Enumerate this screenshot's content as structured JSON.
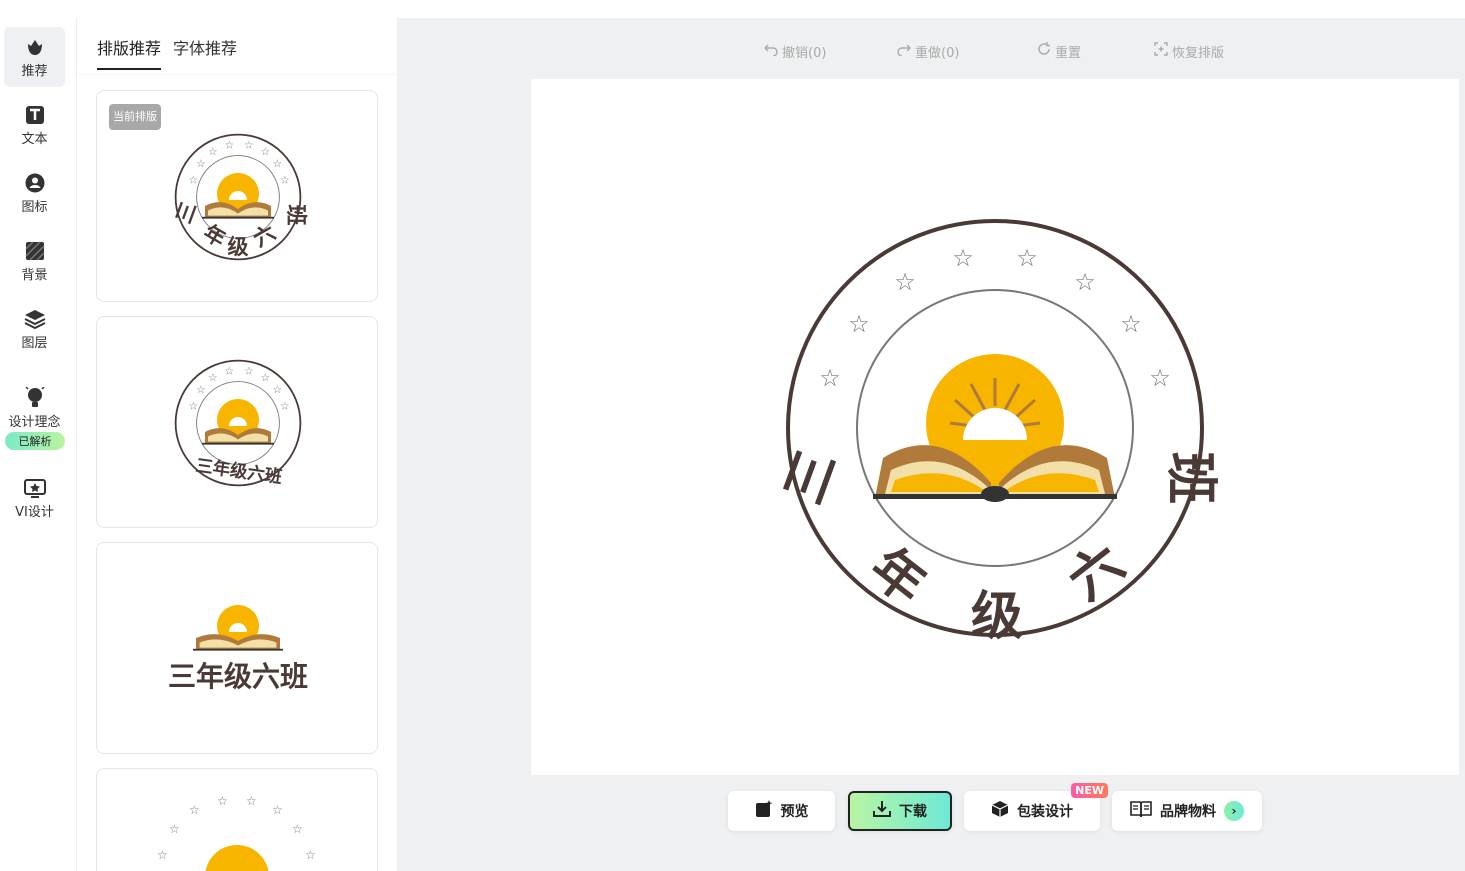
{
  "rail": {
    "items": [
      {
        "label": "推荐",
        "icon": "tulip-icon"
      },
      {
        "label": "文本",
        "icon": "text-icon"
      },
      {
        "label": "图标",
        "icon": "user-circle-icon"
      },
      {
        "label": "背景",
        "icon": "background-icon"
      },
      {
        "label": "图层",
        "icon": "layers-icon"
      },
      {
        "label": "设计理念",
        "icon": "lightbulb-icon"
      },
      {
        "label": "VI设计",
        "icon": "vi-design-icon"
      }
    ],
    "parsed_badge": "已解析"
  },
  "panel": {
    "tabs": [
      {
        "label": "排版推荐",
        "active": true
      },
      {
        "label": "字体推荐",
        "active": false
      }
    ],
    "current_tag": "当前排版",
    "cards": [
      {
        "variant": "round-spaced",
        "text": "三 年 级 六 班"
      },
      {
        "variant": "round-compact",
        "text": "三年级六班"
      },
      {
        "variant": "horizontal",
        "text": "三年级六班"
      },
      {
        "variant": "stars-arc",
        "text": ""
      }
    ]
  },
  "toolbar": {
    "undo": "撤销(0)",
    "redo": "重做(0)",
    "reset": "重置",
    "restore": "恢复排版"
  },
  "logo": {
    "text_left": "三",
    "text_right": "班",
    "text_bottom": [
      "年",
      "级",
      "六"
    ],
    "colors": {
      "ring": "#4a3a35",
      "sun": "#f7b500",
      "book_brown": "#b07a3a",
      "book_cream": "#f3dfa8",
      "stars": "#777777"
    }
  },
  "bottom": {
    "preview": "预览",
    "download": "下载",
    "package": "包装设计",
    "new_badge": "NEW",
    "brand": "品牌物料"
  },
  "colors": {
    "workspace_bg": "#eef0f1",
    "accent_gradient_start": "#b9f5a3",
    "accent_gradient_end": "#6ee9d6"
  }
}
